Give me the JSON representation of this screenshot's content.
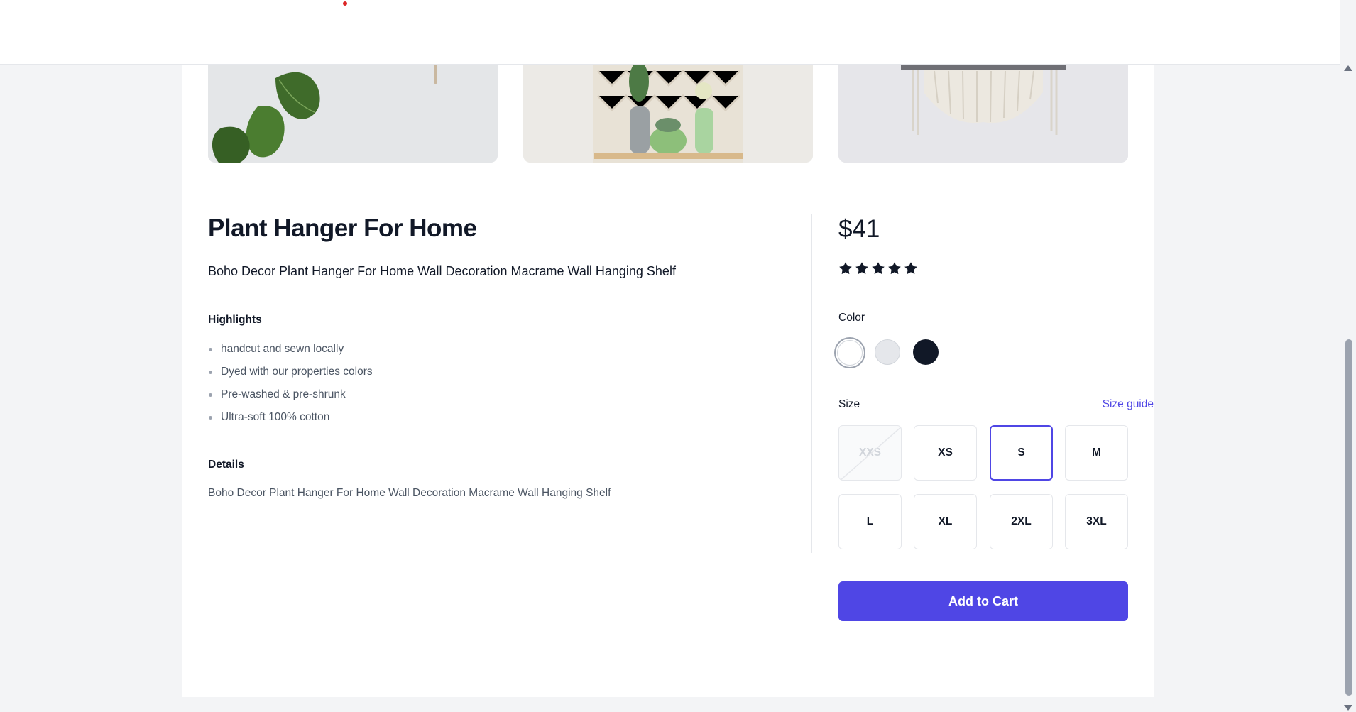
{
  "product": {
    "name": "Plant Hanger For Home",
    "subtitle": "Boho Decor Plant Hanger For Home Wall Decoration Macrame Wall Hanging Shelf",
    "price": "$41",
    "rating": 5,
    "rating_max": 5
  },
  "highlights": {
    "heading": "Highlights",
    "items": [
      "handcut and sewn locally",
      "Dyed with our properties colors",
      "Pre-washed & pre-shrunk",
      "Ultra-soft 100% cotton"
    ]
  },
  "details": {
    "heading": "Details",
    "text": "Boho Decor Plant Hanger For Home Wall Decoration Macrame Wall Hanging Shelf"
  },
  "color": {
    "label": "Color",
    "options": [
      {
        "name": "white",
        "hex": "#ffffff",
        "selected": true
      },
      {
        "name": "gray",
        "hex": "#e5e7eb",
        "selected": false
      },
      {
        "name": "black",
        "hex": "#111827",
        "selected": false
      }
    ]
  },
  "size": {
    "label": "Size",
    "guide_label": "Size guide",
    "options": [
      {
        "label": "XXS",
        "available": false,
        "selected": false
      },
      {
        "label": "XS",
        "available": true,
        "selected": false
      },
      {
        "label": "S",
        "available": true,
        "selected": true
      },
      {
        "label": "M",
        "available": true,
        "selected": false
      },
      {
        "label": "L",
        "available": true,
        "selected": false
      },
      {
        "label": "XL",
        "available": true,
        "selected": false
      },
      {
        "label": "2XL",
        "available": true,
        "selected": false
      },
      {
        "label": "3XL",
        "available": true,
        "selected": false
      }
    ]
  },
  "cart": {
    "add_label": "Add to Cart"
  },
  "colors": {
    "accent": "#4f46e5",
    "text": "#111827",
    "muted": "#4b5563"
  },
  "icons": [
    "star-icon",
    "strike-icon"
  ]
}
